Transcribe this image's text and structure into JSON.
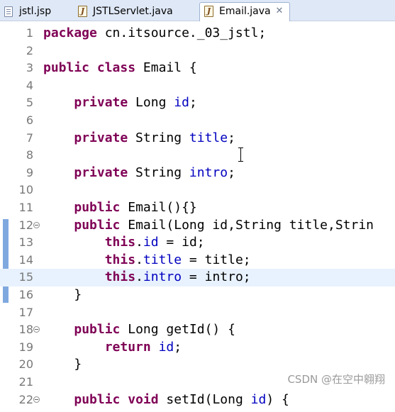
{
  "tabs": [
    {
      "label": "jstl.jsp",
      "icon": "jsp-file-icon"
    },
    {
      "label": "JSTLServlet.java",
      "icon": "java-file-icon"
    },
    {
      "label": "Email.java",
      "icon": "java-file-icon",
      "active": true,
      "close": "✕"
    }
  ],
  "editor": {
    "current_line": 15,
    "lines": [
      {
        "n": "1",
        "segs": [
          [
            "kw",
            "package"
          ],
          [
            "t",
            " cn.itsource._03_jstl;"
          ]
        ]
      },
      {
        "n": "2",
        "segs": []
      },
      {
        "n": "3",
        "segs": [
          [
            "kw",
            "public"
          ],
          [
            "t",
            " "
          ],
          [
            "kw",
            "class"
          ],
          [
            "t",
            " Email {"
          ]
        ]
      },
      {
        "n": "4",
        "segs": []
      },
      {
        "n": "5",
        "segs": [
          [
            "t",
            "    "
          ],
          [
            "kw",
            "private"
          ],
          [
            "t",
            " Long "
          ],
          [
            "fld",
            "id"
          ],
          [
            "t",
            ";"
          ]
        ]
      },
      {
        "n": "6",
        "segs": []
      },
      {
        "n": "7",
        "segs": [
          [
            "t",
            "    "
          ],
          [
            "kw",
            "private"
          ],
          [
            "t",
            " String "
          ],
          [
            "fld",
            "title"
          ],
          [
            "t",
            ";"
          ]
        ]
      },
      {
        "n": "8",
        "segs": []
      },
      {
        "n": "9",
        "segs": [
          [
            "t",
            "    "
          ],
          [
            "kw",
            "private"
          ],
          [
            "t",
            " String "
          ],
          [
            "fld",
            "intro"
          ],
          [
            "t",
            ";"
          ]
        ]
      },
      {
        "n": "10",
        "segs": []
      },
      {
        "n": "11",
        "segs": [
          [
            "t",
            "    "
          ],
          [
            "kw",
            "public"
          ],
          [
            "t",
            " Email(){}"
          ]
        ]
      },
      {
        "n": "12",
        "fold": true,
        "segs": [
          [
            "t",
            "    "
          ],
          [
            "kw",
            "public"
          ],
          [
            "t",
            " Email(Long id,String title,Strin"
          ]
        ]
      },
      {
        "n": "13",
        "segs": [
          [
            "t",
            "        "
          ],
          [
            "kw",
            "this"
          ],
          [
            "t",
            "."
          ],
          [
            "fld",
            "id"
          ],
          [
            "t",
            " = id;"
          ]
        ]
      },
      {
        "n": "14",
        "segs": [
          [
            "t",
            "        "
          ],
          [
            "kw",
            "this"
          ],
          [
            "t",
            "."
          ],
          [
            "fld",
            "title"
          ],
          [
            "t",
            " = title;"
          ]
        ]
      },
      {
        "n": "15",
        "segs": [
          [
            "t",
            "        "
          ],
          [
            "kw",
            "this"
          ],
          [
            "t",
            "."
          ],
          [
            "fld",
            "intro"
          ],
          [
            "t",
            " = intro;"
          ]
        ]
      },
      {
        "n": "16",
        "segs": [
          [
            "t",
            "    }"
          ]
        ]
      },
      {
        "n": "17",
        "segs": []
      },
      {
        "n": "18",
        "fold": true,
        "segs": [
          [
            "t",
            "    "
          ],
          [
            "kw",
            "public"
          ],
          [
            "t",
            " Long getId() {"
          ]
        ]
      },
      {
        "n": "19",
        "segs": [
          [
            "t",
            "        "
          ],
          [
            "kw",
            "return"
          ],
          [
            "t",
            " "
          ],
          [
            "fld",
            "id"
          ],
          [
            "t",
            ";"
          ]
        ]
      },
      {
        "n": "20",
        "segs": [
          [
            "t",
            "    }"
          ]
        ]
      },
      {
        "n": "21",
        "segs": []
      },
      {
        "n": "22",
        "fold": true,
        "segs": [
          [
            "t",
            "    "
          ],
          [
            "kw",
            "public"
          ],
          [
            "t",
            " "
          ],
          [
            "kw",
            "void"
          ],
          [
            "t",
            " setId(Long "
          ],
          [
            "fld",
            "id"
          ],
          [
            "t",
            ") {"
          ]
        ]
      }
    ]
  },
  "watermark": "CSDN @在空中翱翔",
  "colors": {
    "keyword": "#7f0055",
    "field": "#0000c0",
    "current_line": "#e8f2fe",
    "tab_bar": "#dfe8f6",
    "change_marker": "#7fa8df"
  }
}
